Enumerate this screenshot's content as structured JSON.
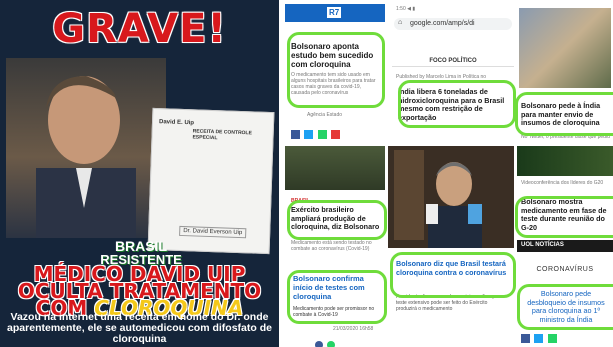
{
  "left": {
    "title": "GRAVE!",
    "doc_name": "David E. Uip",
    "doc_title": "RECEITA DE CONTROLE ESPECIAL",
    "doc_sig": "Dr. David Everson Uip",
    "badge_line1": "BRASIL",
    "badge_line2": "RESISTENTE",
    "headline_line1": "MÉDICO DAVID UIP",
    "headline_line2": "OCULTA TRATAMENTO",
    "headline_prefix": "COM ",
    "headline_highlight": "CLOROQUINA",
    "subtext": "Vazou na internet uma receita em nome do Dr. onde aparentemente, ele se automedicou com difosfato de cloroquina"
  },
  "cards": {
    "r7_logo": "R7",
    "r7_headline": "Bolsonaro aponta estudo bem sucedido com cloroquina",
    "r7_body": "O medicamento tem sido usado em alguns hospitais brasileiros para tratar casos mais graves da covid-19, causada pelo coronavírus",
    "r7_source": "Agência Estado",
    "url": "google.com/amp/s/di",
    "foco_header": "FOCO POLÍTICO",
    "foco_byline": "Published by Marcelo Lima in Política no",
    "foco_headline": "Índia libera 6 toneladas de hidroxicloroquina para o Brasil mesmo com restrição de exportação",
    "india_headline": "Bolsonaro pede à Índia para manter envio de insumos de cloroquina",
    "india_snip": "No Twitter, o presidente disse que pediu",
    "army_label": "BRASIL",
    "army_headline": "Exército brasileiro ampliará produção de cloroquina, diz Bolsonaro",
    "army_body": "Medicamento está sendo testado no combate ao coronavírus (Covid-19)",
    "g20_snip": "Bolsonaro mostra medicamento em fase de teste durante reunião do G-20",
    "g20_date": "Videoconferência dos líderes do G20",
    "confirm_headline": "Bolsonaro confirma início de testes com cloroquina",
    "confirm_body": "Medicamento pode ser promissor no combate à Covid-19",
    "confirm_date": "21/03/2020 16h58",
    "testara_headline": "Bolsonaro diz que Brasil testará cloroquina contra o coronavírus",
    "testara_body": "Presidente disse nas redes sociais confiar que teste extensivo pode ser feito do Exército produzirá o medicamento",
    "uol_header": "UOL NOTÍCIAS",
    "uol_section": "CORONAVÍRUS",
    "uol_headline": "Bolsonaro pede desbloqueio de insumos para cloroquina ao 1º ministro da Índia"
  }
}
